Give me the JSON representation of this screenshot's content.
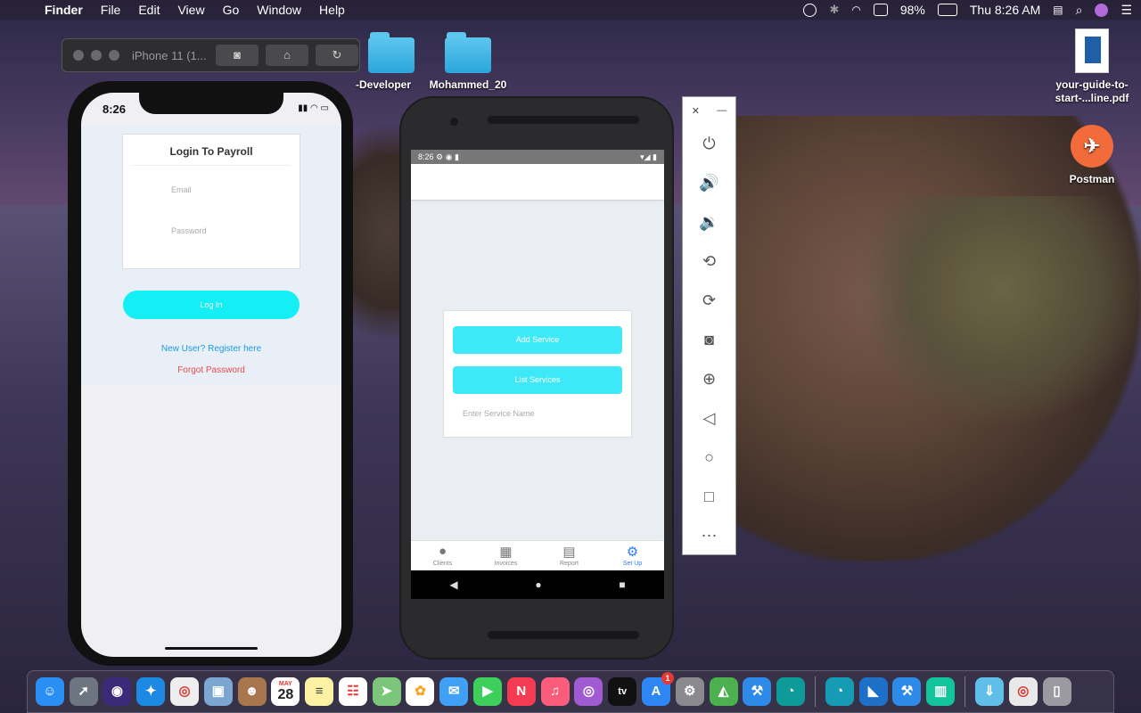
{
  "menubar": {
    "app": "Finder",
    "items": [
      "File",
      "Edit",
      "View",
      "Go",
      "Window",
      "Help"
    ],
    "battery": "98%",
    "clock": "Thu 8:26 AM"
  },
  "desktop": {
    "folder1": "-Developer",
    "folder2": "Mohammed_20",
    "pdf": "your-guide-to-start-...line.pdf",
    "postman": "Postman"
  },
  "simulator": {
    "title": "iPhone 11 (1..."
  },
  "ios": {
    "time": "8:26",
    "login_title": "Login To Payroll",
    "email_placeholder": "Email",
    "password_placeholder": "Password",
    "login_button": "Log In",
    "register_link": "New User? Register here",
    "forgot_link": "Forgot Password"
  },
  "android": {
    "time": "8:26",
    "add_service": "Add Service",
    "list_services": "List Services",
    "service_name_placeholder": "Enter Service Name",
    "tabs": [
      "Clients",
      "Invoices",
      "Report",
      "Set Up"
    ],
    "active_tab": "Set Up"
  },
  "dock": {
    "calendar_month": "MAY",
    "calendar_day": "28",
    "appstore_badge": "1"
  },
  "colors": {
    "cyan": "#14eff6",
    "link_blue": "#1a9be0",
    "link_red": "#e84b4b",
    "tab_active": "#2e7bf6"
  }
}
